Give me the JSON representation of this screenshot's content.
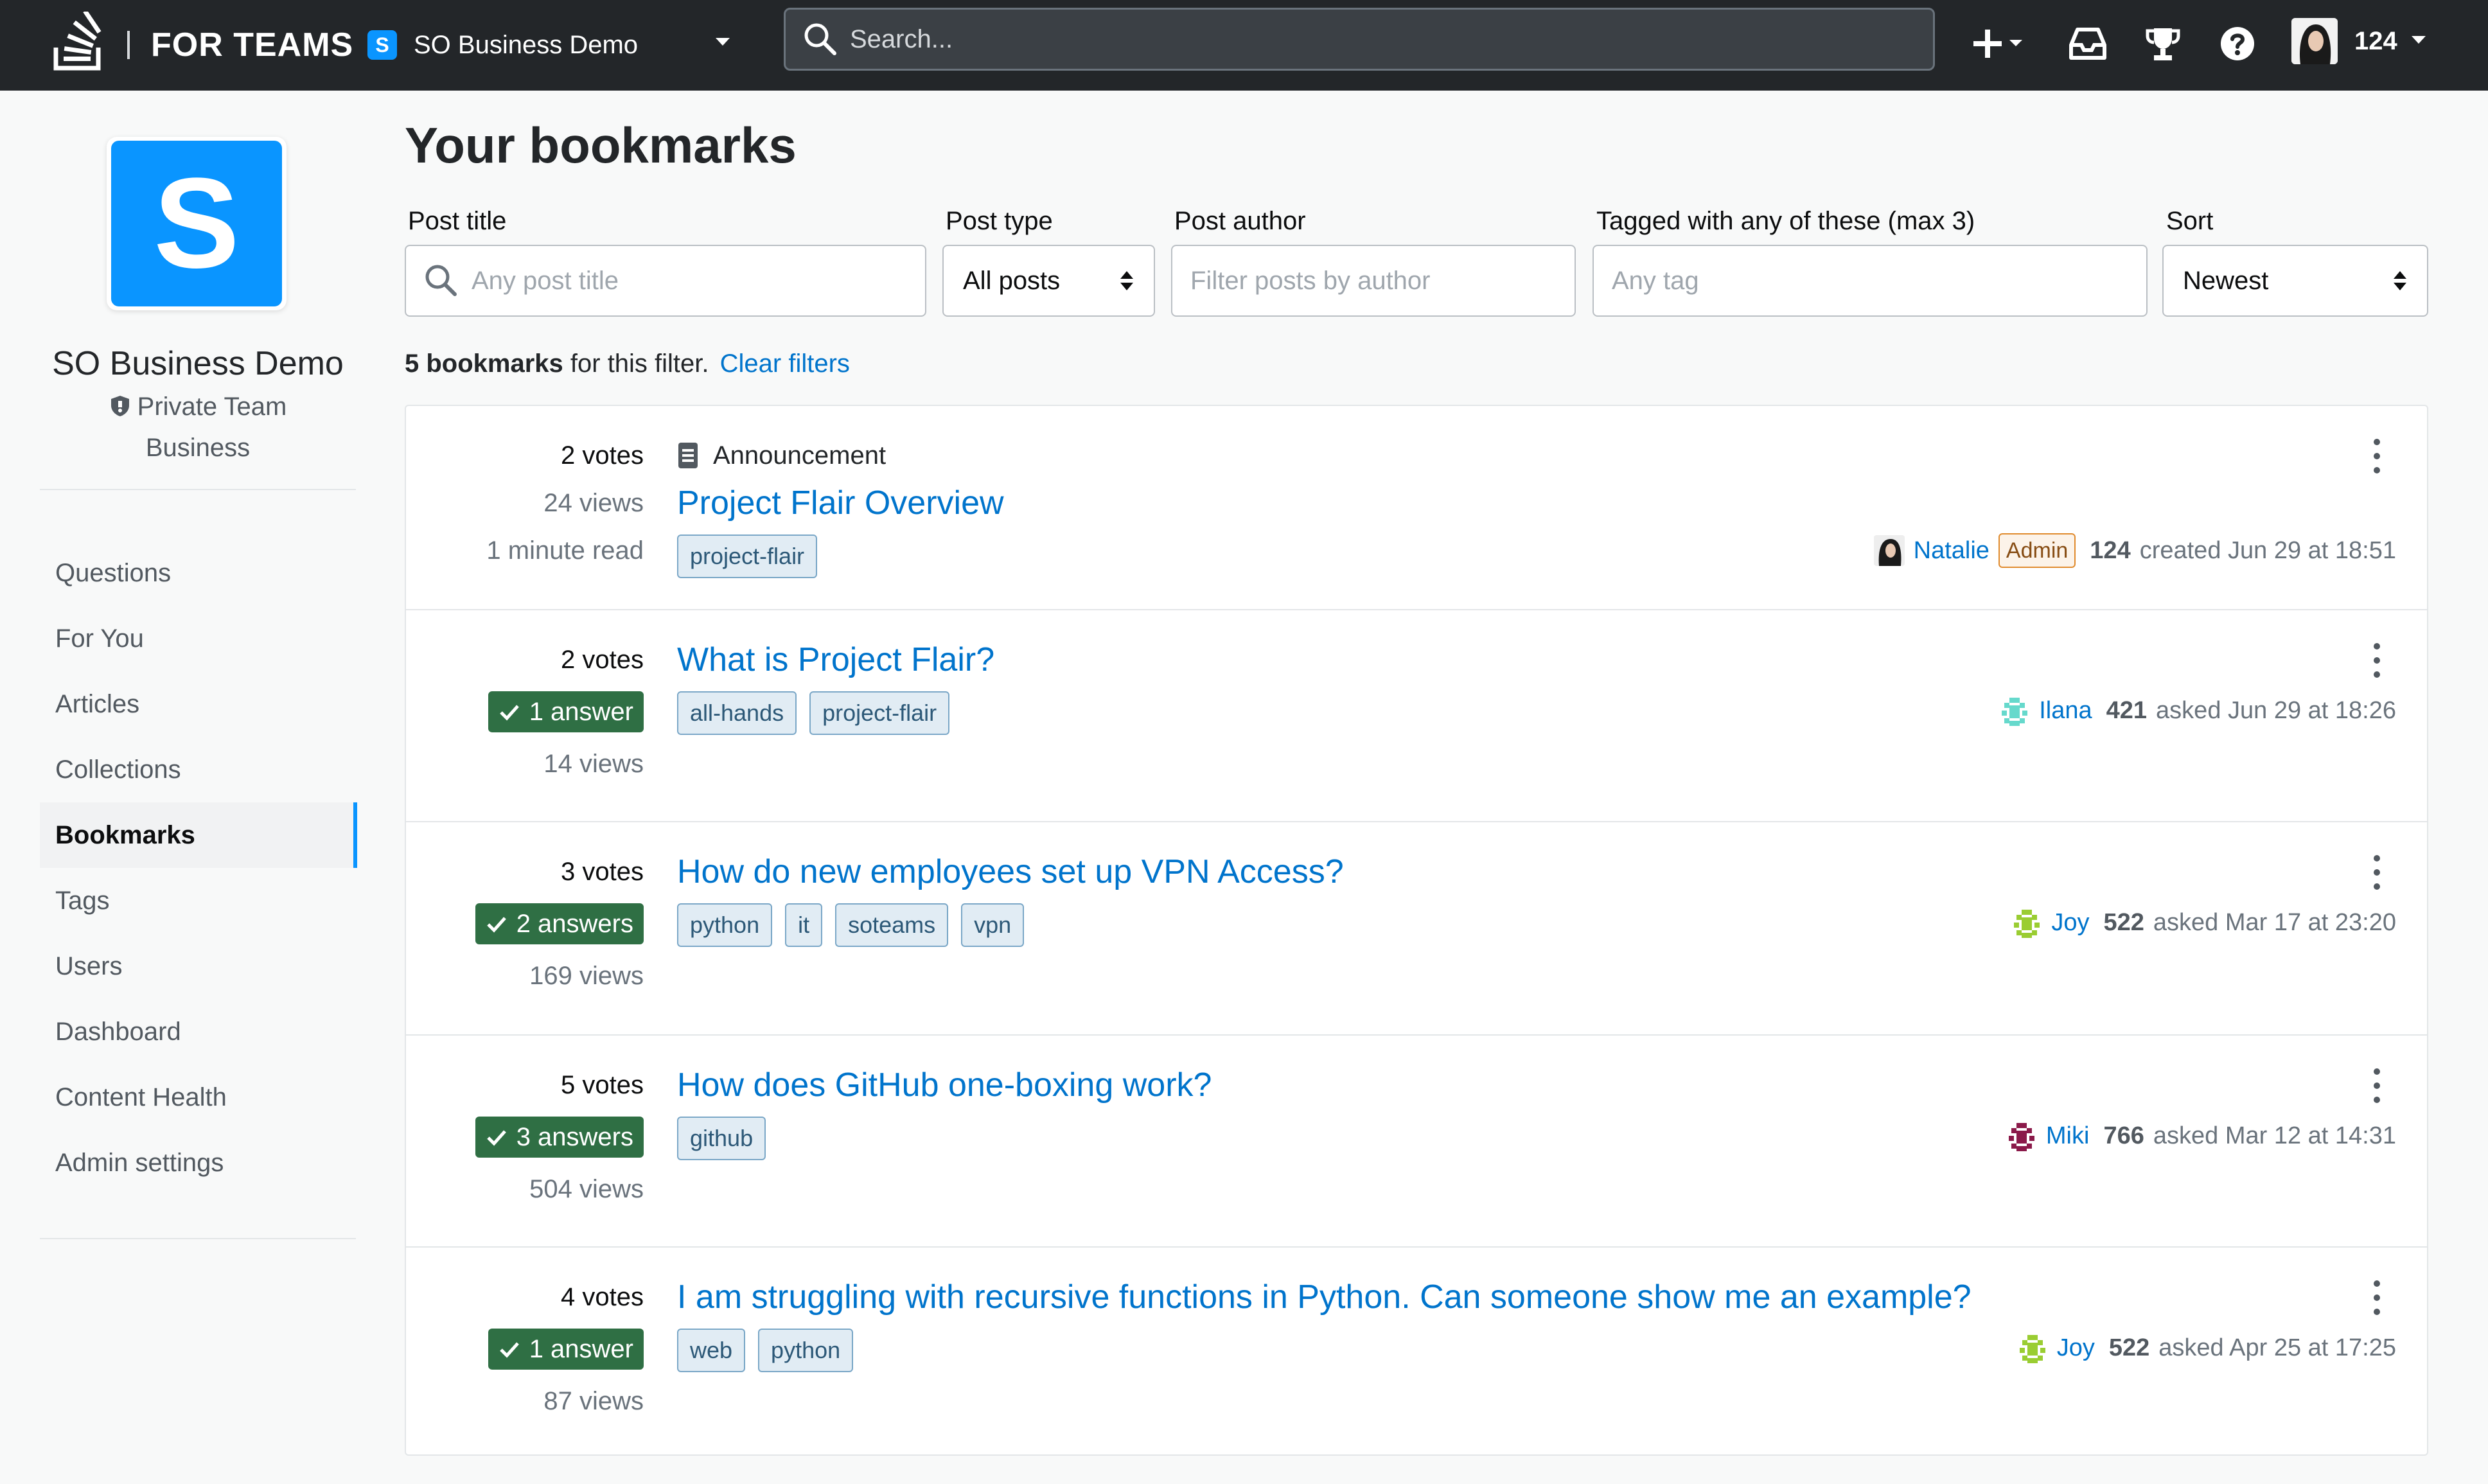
{
  "topbar": {
    "brand": "FOR TEAMS",
    "team_initial": "S",
    "team_name": "SO Business Demo",
    "search_placeholder": "Search...",
    "reputation": "124"
  },
  "sidebar": {
    "logo_letter": "S",
    "team_title": "SO Business Demo",
    "visibility": "Private Team",
    "plan": "Business",
    "nav": [
      {
        "label": "Questions",
        "active": false
      },
      {
        "label": "For You",
        "active": false
      },
      {
        "label": "Articles",
        "active": false
      },
      {
        "label": "Collections",
        "active": false
      },
      {
        "label": "Bookmarks",
        "active": true
      },
      {
        "label": "Tags",
        "active": false
      },
      {
        "label": "Users",
        "active": false
      },
      {
        "label": "Dashboard",
        "active": false
      },
      {
        "label": "Content Health",
        "active": false
      },
      {
        "label": "Admin settings",
        "active": false
      }
    ]
  },
  "filters": {
    "title_label": "Post title",
    "title_placeholder": "Any post title",
    "type_label": "Post type",
    "type_value": "All posts",
    "author_label": "Post author",
    "author_placeholder": "Filter posts by author",
    "tags_label": "Tagged with any of these (max 3)",
    "tags_placeholder": "Any tag",
    "sort_label": "Sort",
    "sort_value": "Newest"
  },
  "page": {
    "title": "Your bookmarks",
    "result_count": "5 bookmarks",
    "result_suffix": " for this filter.",
    "clear_filters": "Clear filters"
  },
  "posts": [
    {
      "votes": "2 votes",
      "views": "24 views",
      "read": "1 minute read",
      "type": "Announcement",
      "title": "Project Flair Overview",
      "tags": [
        "project-flair"
      ],
      "user": "Natalie",
      "badge": "Admin",
      "rep": "124",
      "when": "created Jun 29 at 18:51"
    },
    {
      "votes": "2 votes",
      "answers": "1 answer",
      "views": "14 views",
      "title": "What is Project Flair?",
      "tags": [
        "all-hands",
        "project-flair"
      ],
      "user": "Ilana",
      "rep": "421",
      "when": "asked Jun 29 at 18:26"
    },
    {
      "votes": "3 votes",
      "answers": "2 answers",
      "views": "169 views",
      "title": "How do new employees set up VPN Access?",
      "tags": [
        "python",
        "it",
        "soteams",
        "vpn"
      ],
      "user": "Joy",
      "rep": "522",
      "when": "asked Mar 17 at 23:20"
    },
    {
      "votes": "5 votes",
      "answers": "3 answers",
      "views": "504 views",
      "title": "How does GitHub one-boxing work?",
      "tags": [
        "github"
      ],
      "user": "Miki",
      "rep": "766",
      "when": "asked Mar 12 at 14:31"
    },
    {
      "votes": "4 votes",
      "answers": "1 answer",
      "views": "87 views",
      "title": "I am struggling with recursive functions in Python. Can someone show me an example?",
      "tags": [
        "web",
        "python"
      ],
      "user": "Joy",
      "rep": "522",
      "when": "asked Apr 25 at 17:25"
    }
  ],
  "colors": {
    "topbar": "#232629",
    "accent": "#0a95ff",
    "link": "#0074cc",
    "answered": "#2f6f44",
    "admin_badge": "#e08a2c"
  }
}
